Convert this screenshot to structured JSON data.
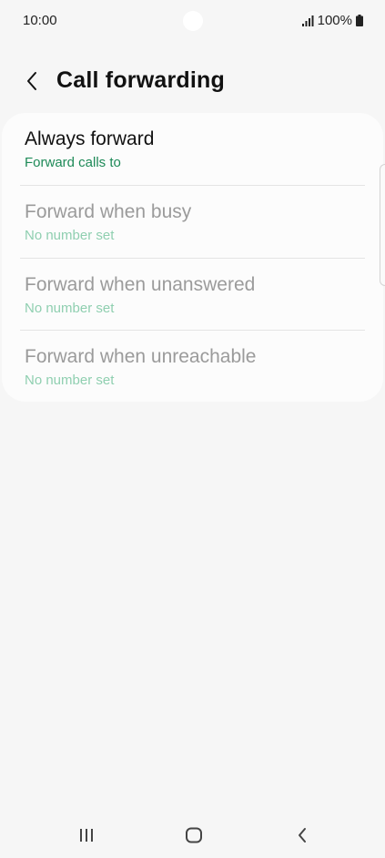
{
  "status_bar": {
    "time": "10:00",
    "battery": "100%",
    "icons": [
      "signal-icon",
      "battery-icon"
    ]
  },
  "header": {
    "back_icon": "chevron-left-icon",
    "title": "Call forwarding"
  },
  "items": [
    {
      "title": "Always forward",
      "subtitle": "Forward calls to",
      "enabled": true
    },
    {
      "title": "Forward when busy",
      "subtitle": "No number set",
      "enabled": false
    },
    {
      "title": "Forward when unanswered",
      "subtitle": "No number set",
      "enabled": false
    },
    {
      "title": "Forward when unreachable",
      "subtitle": "No number set",
      "enabled": false
    }
  ],
  "nav_bar": {
    "icons": [
      "recent-apps-icon",
      "home-icon",
      "back-icon"
    ]
  },
  "colors": {
    "background": "#f6f6f6",
    "card": "#fcfcfc",
    "accent_green": "#1e8a58",
    "disabled_green": "#8fcfb0",
    "disabled_text": "#9b9b9b"
  }
}
